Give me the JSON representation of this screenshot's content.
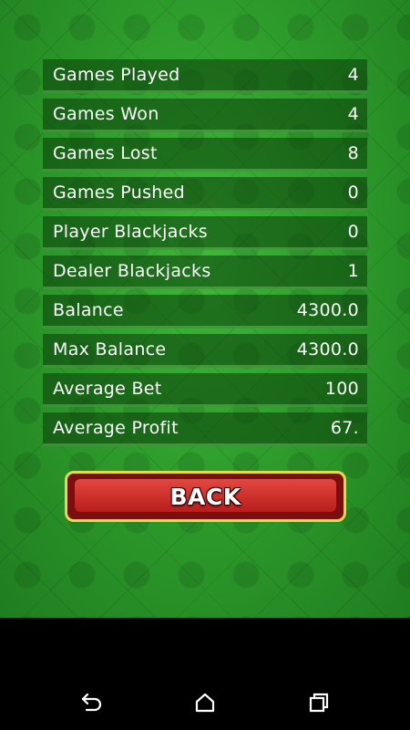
{
  "stats": [
    {
      "label": "Games Played",
      "value": "4"
    },
    {
      "label": "Games Won",
      "value": "4"
    },
    {
      "label": "Games Lost",
      "value": "8"
    },
    {
      "label": "Games Pushed",
      "value": "0"
    },
    {
      "label": "Player Blackjacks",
      "value": "0"
    },
    {
      "label": "Dealer Blackjacks",
      "value": "1"
    },
    {
      "label": "Balance",
      "value": "4300.0"
    },
    {
      "label": "Max Balance",
      "value": "4300.0"
    },
    {
      "label": "Average Bet",
      "value": "100"
    },
    {
      "label": "Average Profit",
      "value": "67."
    }
  ],
  "back_button": {
    "label": "BACK"
  },
  "nav": {
    "icons": [
      "back-icon",
      "home-icon",
      "recents-icon"
    ]
  },
  "colors": {
    "table_green": "#2e9d2c",
    "button_red": "#c9302b",
    "button_border": "#e8d84a",
    "nav_bar": "#000000"
  }
}
